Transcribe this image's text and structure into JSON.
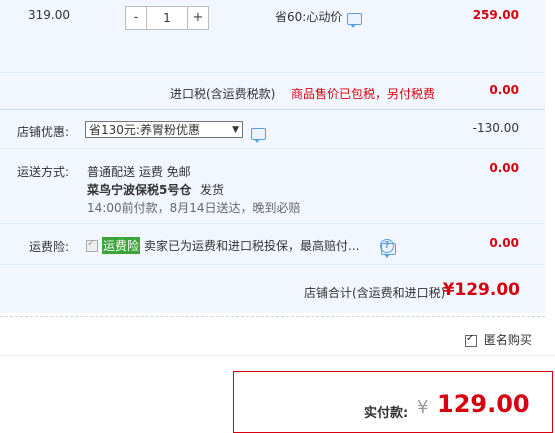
{
  "item": {
    "unit_price": "319.00",
    "qty_minus": "-",
    "qty_value": "1",
    "qty_plus": "+",
    "saving_text": "省60:心动价",
    "subtotal": "259.00"
  },
  "import_tax": {
    "label": "进口税(含运费税款)",
    "note": "商品售价已包税，另付税费",
    "value": "0.00"
  },
  "store_discount": {
    "label": "店铺优惠:",
    "selected": "省130元:养胃粉优惠",
    "value": "-130.00"
  },
  "shipping": {
    "label": "运送方式:",
    "method": "普通配送 运费 免邮",
    "warehouse": "菜鸟宁波保税5号仓",
    "ship_text": "发货",
    "delivery_note": "14:00前付款，8月14日送达，晚到必赔",
    "value": "0.00"
  },
  "insurance": {
    "label": "运费险:",
    "tag": "运费险",
    "desc": "卖家已为运费和进口税投保，最高赔付...",
    "value": "0.00"
  },
  "store_total": {
    "label": "店铺合计(含运费和进口税)",
    "value": "¥129.00"
  },
  "anonymous": {
    "label": "匿名购买"
  },
  "payment": {
    "label": "实付款:",
    "currency": "¥",
    "amount": "129.00"
  },
  "icons": {
    "chat": "chat-bubble-icon",
    "help": "question-circle-icon",
    "dropdown": "chevron-down-icon",
    "checkbox": "checkbox-icon"
  },
  "colors": {
    "price_red": "#d7000f",
    "panel_bg": "#f2f7ff",
    "link_blue": "#5d9de0",
    "tag_green": "#3aa33a"
  }
}
